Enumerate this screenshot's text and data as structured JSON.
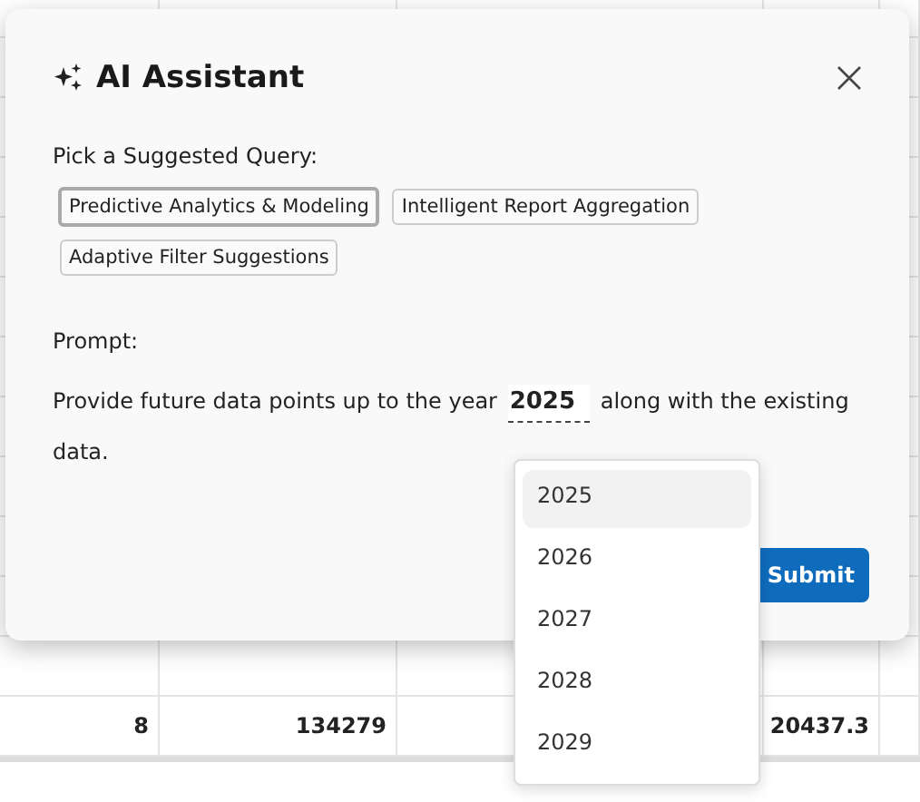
{
  "table": {
    "rows": [
      [
        "",
        "",
        "",
        "",
        ""
      ],
      [
        "",
        "",
        "",
        "",
        ""
      ],
      [
        "",
        "",
        "",
        "",
        ""
      ],
      [
        "",
        "",
        "",
        "",
        ""
      ],
      [
        "",
        "",
        "",
        "",
        ""
      ],
      [
        "",
        "",
        "",
        "",
        ""
      ],
      [
        "",
        "",
        "",
        "",
        ""
      ],
      [
        "",
        "",
        "",
        "",
        ""
      ],
      [
        "",
        "",
        "",
        "",
        ""
      ],
      [
        "",
        "",
        "",
        "",
        ""
      ],
      [
        "",
        "",
        "",
        "",
        ""
      ],
      [
        "",
        "",
        "",
        "",
        ""
      ],
      [
        "8",
        "134279",
        "",
        "20437.3",
        ""
      ]
    ]
  },
  "dialog": {
    "title": "AI Assistant",
    "suggest_label": "Pick a Suggested Query:",
    "suggestions": [
      {
        "label": "Predictive Analytics & Modeling",
        "selected": true
      },
      {
        "label": "Intelligent Report Aggregation",
        "selected": false
      },
      {
        "label": "Adaptive Filter Suggestions",
        "selected": false
      }
    ],
    "prompt_label": "Prompt:",
    "prompt_before": "Provide future data points up to the year",
    "year": "2025",
    "prompt_after": "along with the existing data.",
    "submit": "Submit"
  },
  "year_menu": [
    {
      "label": "2025",
      "selected": true
    },
    {
      "label": "2026",
      "selected": false
    },
    {
      "label": "2027",
      "selected": false
    },
    {
      "label": "2028",
      "selected": false
    },
    {
      "label": "2029",
      "selected": false
    }
  ]
}
